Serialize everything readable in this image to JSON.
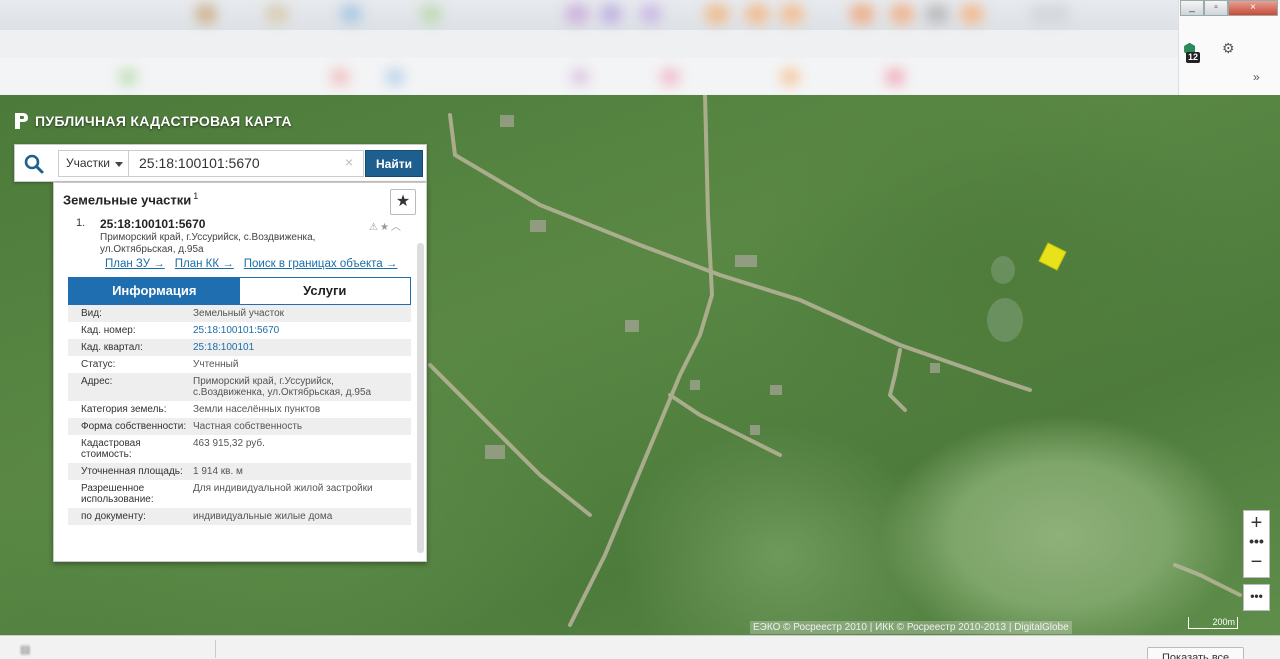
{
  "browser": {
    "ext_badge": "12",
    "more_label": "»"
  },
  "app": {
    "title": "ПУБЛИЧНАЯ КАДАСТРОВАЯ КАРТА"
  },
  "search": {
    "type_label": "Участки",
    "query": "25:18:100101:5670",
    "clear_label": "×",
    "find_label": "Найти"
  },
  "panel": {
    "title": "Земельные участки",
    "count": "1",
    "result": {
      "number": "1.",
      "cadastral": "25:18:100101:5670",
      "address": "Приморский край, г.Уссурийск, с.Воздвиженка, ул.Октябрьская, д.95а"
    },
    "links": [
      "План ЗУ →",
      "План КК →",
      "Поиск в границах объекта →"
    ],
    "tabs": {
      "info": "Информация",
      "services": "Услуги"
    },
    "rows": [
      {
        "key": "Вид:",
        "value": "Земельный участок"
      },
      {
        "key": "Кад. номер:",
        "value": "25:18:100101:5670"
      },
      {
        "key": "Кад. квартал:",
        "value": "25:18:100101"
      },
      {
        "key": "Статус:",
        "value": "Учтенный"
      },
      {
        "key": "Адрес:",
        "value": "Приморский край, г.Уссурийск, с.Воздвиженка, ул.Октябрьская, д.95а"
      },
      {
        "key": "Категория земель:",
        "value": "Земли населённых пунктов"
      },
      {
        "key": "Форма собственности:",
        "value": "Частная собственность"
      },
      {
        "key": "Кадастровая стоимость:",
        "value": "463 915,32 руб."
      },
      {
        "key": "Уточненная площадь:",
        "value": "1 914 кв. м"
      },
      {
        "key": "Разрешенное использование:",
        "value": "Для индивидуальной жилой застройки"
      },
      {
        "key": "по документу:",
        "value": "индивидуальные жилые дома"
      }
    ]
  },
  "map": {
    "zoom_in": "+",
    "zoom_out": "−",
    "dots": "•••",
    "attribution": "ЕЭКО © Росреестр 2010 | ИКК © Росреестр 2010-2013 | DigitalGlobe",
    "scale": "200m",
    "parcel_color": "#e8e21a"
  },
  "downloads": {
    "show_all": "Показать все"
  }
}
